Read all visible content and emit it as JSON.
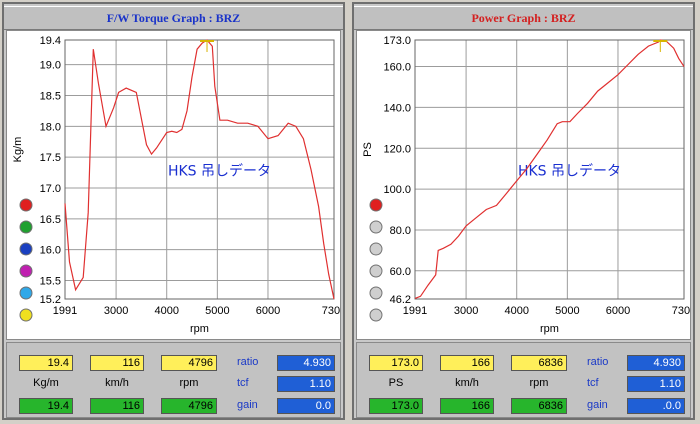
{
  "colors": {
    "torque_line": "#e03030",
    "power_line": "#e03030",
    "torque_title": "#1a33c9",
    "power_title": "#d42020",
    "overlay_text": "#1a2fd0"
  },
  "panels": [
    {
      "title": "F/W Torque Graph : BRZ",
      "ylabel": "Kg/m",
      "xlabel": "rpm",
      "overlay": "HKS 吊しデータ",
      "chart_data": {
        "type": "line",
        "x_range": [
          1991,
          7304
        ],
        "y_range": [
          15.2,
          19.4
        ],
        "x_ticks": [
          "1991",
          "3000",
          "4000",
          "5000",
          "6000",
          "7304"
        ],
        "y_ticks": [
          "19.4",
          "19.0",
          "18.5",
          "18.0",
          "17.5",
          "17.0",
          "16.5",
          "16.0",
          "15.5",
          "15.2"
        ],
        "peak_rpm": 4796,
        "series": [
          {
            "x": [
              1991,
              2080,
              2200,
              2350,
              2450,
              2550,
              2650,
              2800,
              2950,
              3050,
              3200,
              3400,
              3600,
              3700,
              3800,
              4000,
              4100,
              4200,
              4300,
              4400,
              4500,
              4600,
              4700,
              4796,
              4900,
              4950,
              5050,
              5200,
              5400,
              5600,
              5800,
              6000,
              6200,
              6400,
              6550,
              6700,
              6850,
              7000,
              7100,
              7200,
              7304
            ],
            "y": [
              16.75,
              15.8,
              15.35,
              15.55,
              16.6,
              19.25,
              18.7,
              18.0,
              18.3,
              18.55,
              18.62,
              18.55,
              17.7,
              17.55,
              17.65,
              17.9,
              17.92,
              17.9,
              17.95,
              18.25,
              18.8,
              19.25,
              19.35,
              19.4,
              19.3,
              18.65,
              18.1,
              18.1,
              18.05,
              18.05,
              18.0,
              17.8,
              17.85,
              18.05,
              18.0,
              17.8,
              17.3,
              16.7,
              16.1,
              15.6,
              15.2
            ]
          }
        ]
      },
      "indicators": [
        "#e02020",
        "#20a030",
        "#1a40c0",
        "#c020b0",
        "#30a8e8",
        "#f0e020"
      ],
      "readout": {
        "top": [
          "19.4",
          "116",
          "4796"
        ],
        "units": [
          "Kg/m",
          "km/h",
          "rpm"
        ],
        "bottom": [
          "19.4",
          "116",
          "4796"
        ],
        "params": [
          {
            "label": "ratio",
            "value": "4.930"
          },
          {
            "label": "tcf",
            "value": "1.10"
          },
          {
            "label": "gain",
            "value": "0.0"
          }
        ]
      }
    },
    {
      "title": "Power Graph : BRZ",
      "ylabel": "PS",
      "xlabel": "rpm",
      "overlay": "HKS 吊しデータ",
      "chart_data": {
        "type": "line",
        "x_range": [
          1991,
          7304
        ],
        "y_range": [
          46.2,
          173.0
        ],
        "x_ticks": [
          "1991",
          "3000",
          "4000",
          "5000",
          "6000",
          "7304"
        ],
        "y_ticks": [
          "173.0",
          "160.0",
          "140.0",
          "120.0",
          "100.0",
          "80.0",
          "60.0",
          "46.2"
        ],
        "peak_rpm": 6836,
        "series": [
          {
            "x": [
              1991,
              2100,
              2250,
              2400,
              2450,
              2550,
              2700,
              2850,
              3000,
              3200,
              3400,
              3600,
              3800,
              4000,
              4200,
              4400,
              4600,
              4800,
              4900,
              5050,
              5200,
              5400,
              5600,
              5800,
              6000,
              6200,
              6400,
              6600,
              6800,
              6836,
              6950,
              7100,
              7200,
              7304
            ],
            "y": [
              46.5,
              47.5,
              53,
              58,
              70,
              71,
              73,
              77,
              82,
              86,
              90,
              92,
              98,
              104,
              110,
              117,
              124,
              132,
              133,
              133,
              137,
              142,
              148,
              152,
              156,
              161,
              166,
              170,
              172,
              173,
              172.5,
              169,
              164,
              160
            ]
          }
        ]
      },
      "indicators": [
        "#e02020",
        "#cfcfcf",
        "#cfcfcf",
        "#cfcfcf",
        "#cfcfcf",
        "#cfcfcf"
      ],
      "readout": {
        "top": [
          "173.0",
          "166",
          "6836"
        ],
        "units": [
          "PS",
          "km/h",
          "rpm"
        ],
        "bottom": [
          "173.0",
          "166",
          "6836"
        ],
        "params": [
          {
            "label": "ratio",
            "value": "4.930"
          },
          {
            "label": "tcf",
            "value": "1.10"
          },
          {
            "label": "gain",
            "value": ".0.0"
          }
        ]
      }
    }
  ]
}
